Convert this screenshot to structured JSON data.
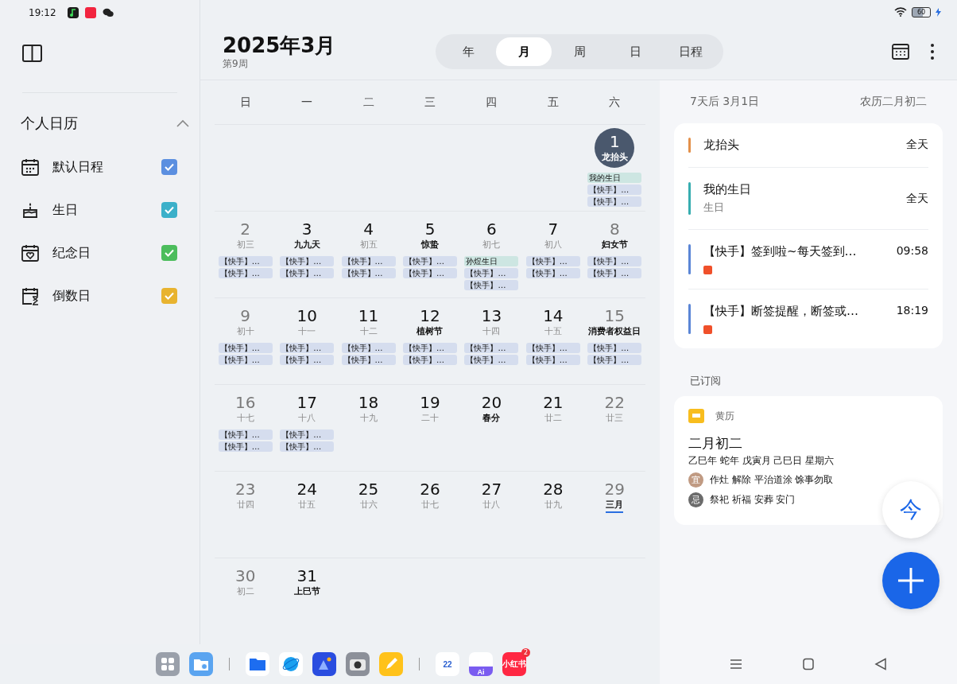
{
  "status_bar": {
    "time": "19:12",
    "battery": "60",
    "notifications": [
      {
        "kind": "music",
        "color": "#1c1c1c"
      },
      {
        "kind": "red-app",
        "color": "#f2243f"
      },
      {
        "kind": "chat",
        "color": "#222222"
      }
    ]
  },
  "sidebar": {
    "section": {
      "title": "个人日历",
      "expanded": true
    },
    "calendars": [
      {
        "name": "默认日程",
        "color": "#5b8fe0",
        "checked": true
      },
      {
        "name": "生日",
        "color": "#3bb0c9",
        "checked": true
      },
      {
        "name": "纪念日",
        "color": "#4cbd5c",
        "checked": true
      },
      {
        "name": "倒数日",
        "color": "#e8b32f",
        "checked": true
      }
    ]
  },
  "header": {
    "title": "2025年3月",
    "week": "第9周",
    "tabs": [
      {
        "label": "年",
        "selected": false
      },
      {
        "label": "月",
        "selected": true
      },
      {
        "label": "周",
        "selected": false
      },
      {
        "label": "日",
        "selected": false
      },
      {
        "label": "日程",
        "selected": false
      }
    ]
  },
  "calendar": {
    "weekdays": [
      "日",
      "一",
      "二",
      "三",
      "四",
      "五",
      "六"
    ],
    "weeks": [
      {
        "cells": [
          {
            "kind": "blank"
          },
          {
            "kind": "blank"
          },
          {
            "kind": "blank"
          },
          {
            "kind": "blank"
          },
          {
            "kind": "blank"
          },
          {
            "kind": "blank"
          },
          {
            "kind": "day",
            "day": "1",
            "lunar": "龙抬头",
            "festival": true,
            "selected": true,
            "underlined": false,
            "events": [
              {
                "kind": "birthday",
                "text": "我的生日"
              },
              {
                "kind": "app",
                "text": "【快手】…"
              },
              {
                "kind": "app",
                "text": "【快手】…"
              }
            ]
          }
        ]
      },
      {
        "cells": [
          {
            "kind": "day",
            "day": "2",
            "lunar": "初三",
            "festival": false,
            "weekend": true,
            "selected": false,
            "underlined": false,
            "events": [
              {
                "kind": "app",
                "text": "【快手】…"
              },
              {
                "kind": "app",
                "text": "【快手】…"
              }
            ]
          },
          {
            "kind": "day",
            "day": "3",
            "lunar": "九九天",
            "festival": true,
            "weekend": false,
            "selected": false,
            "underlined": false,
            "events": [
              {
                "kind": "app",
                "text": "【快手】…"
              },
              {
                "kind": "app",
                "text": "【快手】…"
              }
            ]
          },
          {
            "kind": "day",
            "day": "4",
            "lunar": "初五",
            "festival": false,
            "weekend": false,
            "selected": false,
            "underlined": false,
            "events": [
              {
                "kind": "app",
                "text": "【快手】…"
              },
              {
                "kind": "app",
                "text": "【快手】…"
              }
            ]
          },
          {
            "kind": "day",
            "day": "5",
            "lunar": "惊蛰",
            "festival": true,
            "weekend": false,
            "selected": false,
            "underlined": false,
            "events": [
              {
                "kind": "app",
                "text": "【快手】…"
              },
              {
                "kind": "app",
                "text": "【快手】…"
              }
            ]
          },
          {
            "kind": "day",
            "day": "6",
            "lunar": "初七",
            "festival": false,
            "weekend": false,
            "selected": false,
            "underlined": false,
            "events": [
              {
                "kind": "birthday",
                "text": "孙煜生日"
              },
              {
                "kind": "app",
                "text": "【快手】…"
              },
              {
                "kind": "app",
                "text": "【快手】…"
              }
            ]
          },
          {
            "kind": "day",
            "day": "7",
            "lunar": "初八",
            "festival": false,
            "weekend": false,
            "selected": false,
            "underlined": false,
            "events": [
              {
                "kind": "app",
                "text": "【快手】…"
              },
              {
                "kind": "app",
                "text": "【快手】…"
              }
            ]
          },
          {
            "kind": "day",
            "day": "8",
            "lunar": "妇女节",
            "festival": true,
            "weekend": true,
            "selected": false,
            "underlined": false,
            "events": [
              {
                "kind": "app",
                "text": "【快手】…"
              },
              {
                "kind": "app",
                "text": "【快手】…"
              }
            ]
          }
        ]
      },
      {
        "cells": [
          {
            "kind": "day",
            "day": "9",
            "lunar": "初十",
            "festival": false,
            "weekend": true,
            "selected": false,
            "underlined": false,
            "events": [
              {
                "kind": "app",
                "text": "【快手】…"
              },
              {
                "kind": "app",
                "text": "【快手】…"
              }
            ]
          },
          {
            "kind": "day",
            "day": "10",
            "lunar": "十一",
            "festival": false,
            "weekend": false,
            "selected": false,
            "underlined": false,
            "events": [
              {
                "kind": "app",
                "text": "【快手】…"
              },
              {
                "kind": "app",
                "text": "【快手】…"
              }
            ]
          },
          {
            "kind": "day",
            "day": "11",
            "lunar": "十二",
            "festival": false,
            "weekend": false,
            "selected": false,
            "underlined": false,
            "events": [
              {
                "kind": "app",
                "text": "【快手】…"
              },
              {
                "kind": "app",
                "text": "【快手】…"
              }
            ]
          },
          {
            "kind": "day",
            "day": "12",
            "lunar": "植树节",
            "festival": true,
            "weekend": false,
            "selected": false,
            "underlined": false,
            "events": [
              {
                "kind": "app",
                "text": "【快手】…"
              },
              {
                "kind": "app",
                "text": "【快手】…"
              }
            ]
          },
          {
            "kind": "day",
            "day": "13",
            "lunar": "十四",
            "festival": false,
            "weekend": false,
            "selected": false,
            "underlined": false,
            "events": [
              {
                "kind": "app",
                "text": "【快手】…"
              },
              {
                "kind": "app",
                "text": "【快手】…"
              }
            ]
          },
          {
            "kind": "day",
            "day": "14",
            "lunar": "十五",
            "festival": false,
            "weekend": false,
            "selected": false,
            "underlined": false,
            "events": [
              {
                "kind": "app",
                "text": "【快手】…"
              },
              {
                "kind": "app",
                "text": "【快手】…"
              }
            ]
          },
          {
            "kind": "day",
            "day": "15",
            "lunar": "消费者权益日",
            "festival": true,
            "weekend": true,
            "selected": false,
            "underlined": false,
            "events": [
              {
                "kind": "app",
                "text": "【快手】…"
              },
              {
                "kind": "app",
                "text": "【快手】…"
              }
            ]
          }
        ]
      },
      {
        "cells": [
          {
            "kind": "day",
            "day": "16",
            "lunar": "十七",
            "festival": false,
            "weekend": true,
            "selected": false,
            "underlined": false,
            "events": [
              {
                "kind": "app",
                "text": "【快手】…"
              },
              {
                "kind": "app",
                "text": "【快手】…"
              }
            ]
          },
          {
            "kind": "day",
            "day": "17",
            "lunar": "十八",
            "festival": false,
            "weekend": false,
            "selected": false,
            "underlined": false,
            "events": [
              {
                "kind": "app",
                "text": "【快手】…"
              },
              {
                "kind": "app",
                "text": "【快手】…"
              }
            ]
          },
          {
            "kind": "day",
            "day": "18",
            "lunar": "十九",
            "festival": false,
            "weekend": false,
            "selected": false,
            "underlined": false
          },
          {
            "kind": "day",
            "day": "19",
            "lunar": "二十",
            "festival": false,
            "weekend": false,
            "selected": false,
            "underlined": false
          },
          {
            "kind": "day",
            "day": "20",
            "lunar": "春分",
            "festival": true,
            "weekend": false,
            "selected": false,
            "underlined": false
          },
          {
            "kind": "day",
            "day": "21",
            "lunar": "廿二",
            "festival": false,
            "weekend": false,
            "selected": false,
            "underlined": false
          },
          {
            "kind": "day",
            "day": "22",
            "lunar": "廿三",
            "festival": false,
            "weekend": true,
            "selected": false,
            "underlined": false
          }
        ]
      },
      {
        "cells": [
          {
            "kind": "day",
            "day": "23",
            "lunar": "廿四",
            "festival": false,
            "weekend": true,
            "selected": false,
            "underlined": false
          },
          {
            "kind": "day",
            "day": "24",
            "lunar": "廿五",
            "festival": false,
            "weekend": false,
            "selected": false,
            "underlined": false
          },
          {
            "kind": "day",
            "day": "25",
            "lunar": "廿六",
            "festival": false,
            "weekend": false,
            "selected": false,
            "underlined": false
          },
          {
            "kind": "day",
            "day": "26",
            "lunar": "廿七",
            "festival": false,
            "weekend": false,
            "selected": false,
            "underlined": false
          },
          {
            "kind": "day",
            "day": "27",
            "lunar": "廿八",
            "festival": false,
            "weekend": false,
            "selected": false,
            "underlined": false
          },
          {
            "kind": "day",
            "day": "28",
            "lunar": "廿九",
            "festival": false,
            "weekend": false,
            "selected": false,
            "underlined": false
          },
          {
            "kind": "day",
            "day": "29",
            "lunar": "三月",
            "festival": true,
            "weekend": true,
            "selected": false,
            "underlined": true
          }
        ]
      },
      {
        "cells": [
          {
            "kind": "day",
            "day": "30",
            "lunar": "初二",
            "festival": false,
            "weekend": true,
            "selected": false,
            "underlined": false
          },
          {
            "kind": "day",
            "day": "31",
            "lunar": "上巳节",
            "festival": true,
            "weekend": false,
            "selected": false,
            "underlined": false
          }
        ]
      }
    ]
  },
  "detail": {
    "date": "7天后 3月1日",
    "lunar": "农历二月初二",
    "events": [
      {
        "title": "龙抬头",
        "time": "全天",
        "color": "#e3904a",
        "app_badge": false
      },
      {
        "title": "我的生日",
        "subtitle": "生日",
        "time": "全天",
        "color": "#37adb0",
        "app_badge": false
      },
      {
        "title": "【快手】签到啦~每天签到…",
        "time": "09:58",
        "color": "#5b86d6",
        "app_badge": true
      },
      {
        "title": "【快手】断签提醒，断签或…",
        "time": "18:19",
        "color": "#5b86d6",
        "app_badge": true
      }
    ]
  },
  "subscribed": {
    "label": "已订阅",
    "source": "黄历",
    "lunar_date": "二月初二",
    "ganzhi": "乙巳年 蛇年 戊寅月 己巳日 星期六",
    "omens": [
      {
        "mark": "宜",
        "text": "作灶 解除 平治道涂 馀事勿取",
        "color": "#c09a82"
      },
      {
        "mark": "忌",
        "text": "祭祀 祈福 安葬 安门",
        "color": "#6b6b6b"
      }
    ]
  },
  "fabs": [
    {
      "kind": "today",
      "label": "今"
    },
    {
      "kind": "add"
    }
  ],
  "dock": {
    "apps": [
      {
        "kind": "apps"
      },
      {
        "kind": "folder"
      },
      {
        "kind": "divider"
      },
      {
        "kind": "files"
      },
      {
        "kind": "browser"
      },
      {
        "kind": "gallery"
      },
      {
        "kind": "camera"
      },
      {
        "kind": "notes"
      },
      {
        "kind": "divider"
      },
      {
        "kind": "calendar",
        "label": "22"
      },
      {
        "kind": "assistant",
        "label": "Ai"
      },
      {
        "kind": "rednote",
        "label": "小红书",
        "badge": "2"
      }
    ]
  }
}
